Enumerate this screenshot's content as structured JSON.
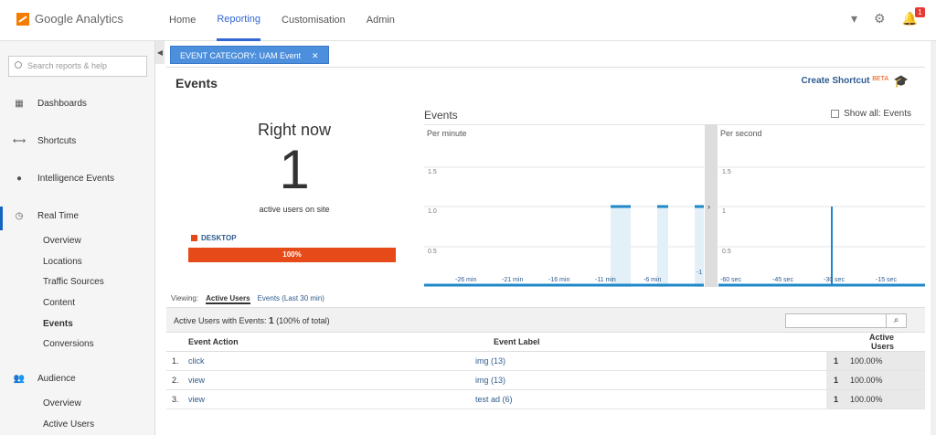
{
  "app": {
    "name": "Google Analytics",
    "nav": [
      "Home",
      "Reporting",
      "Customisation",
      "Admin"
    ],
    "notification_count": "1"
  },
  "sidebar": {
    "search_placeholder": "Search reports & help",
    "items": [
      {
        "label": "Dashboards",
        "icon": "grid-icon"
      },
      {
        "label": "Shortcuts",
        "icon": "arrow-icon"
      },
      {
        "label": "Intelligence Events",
        "icon": "lightbulb-icon"
      },
      {
        "label": "Real Time",
        "icon": "clock-icon"
      },
      {
        "label": "Audience",
        "icon": "people-icon"
      }
    ],
    "realtime_sub": [
      "Overview",
      "Locations",
      "Traffic Sources",
      "Content",
      "Events",
      "Conversions"
    ],
    "audience_sub": [
      "Overview",
      "Active Users"
    ]
  },
  "filter": {
    "label": "EVENT CATEGORY: UAM Event"
  },
  "page": {
    "title": "Events",
    "shortcut": "Create Shortcut",
    "beta": "BETA"
  },
  "rightnow": {
    "label": "Right now",
    "count": "1",
    "sub": "active users on site",
    "device": "DESKTOP",
    "device_pct": "100%"
  },
  "chart": {
    "title": "Events",
    "show_all": "Show all: Events",
    "per_minute": "Per minute",
    "per_second": "Per second",
    "min_ticks": [
      "-26 min",
      "-21 min",
      "-16 min",
      "-11 min",
      "-6 min",
      "-1"
    ],
    "sec_ticks": [
      "-60 sec",
      "-45 sec",
      "-30 sec",
      "-15 sec"
    ],
    "y_ticks": [
      "1.5",
      "1.0",
      "0.5"
    ],
    "y_ticks_sec": [
      "1.5",
      "1",
      "0.5"
    ]
  },
  "viewing": {
    "label": "Viewing:",
    "active": "Active Users",
    "other": "Events (Last 30 min)"
  },
  "stats": {
    "label": "Active Users with Events:",
    "value": "1",
    "detail": "(100% of total)"
  },
  "table": {
    "headers": [
      "Event Action",
      "Event Label",
      "Active Users"
    ],
    "rows": [
      {
        "idx": "1.",
        "action": "click",
        "label": "img (13)",
        "n": "1",
        "pct": "100.00%"
      },
      {
        "idx": "2.",
        "action": "view",
        "label": "img (13)",
        "n": "1",
        "pct": "100.00%"
      },
      {
        "idx": "3.",
        "action": "view",
        "label": "test ad (6)",
        "n": "1",
        "pct": "100.00%"
      }
    ]
  }
}
